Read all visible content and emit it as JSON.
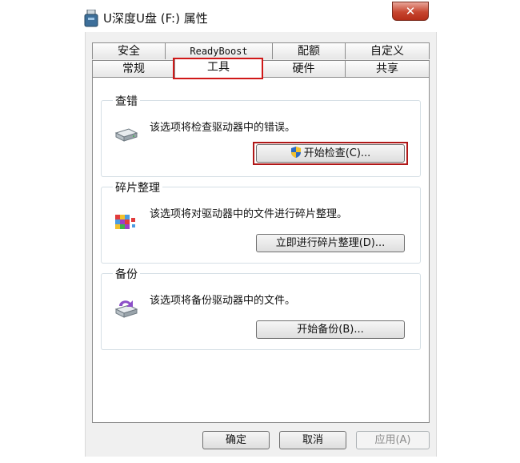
{
  "window": {
    "title": "U深度U盘 (F:) 属性",
    "close_label": "✕"
  },
  "tabs": {
    "top_row": [
      {
        "label": "安全"
      },
      {
        "label": "ReadyBoost"
      },
      {
        "label": "配额"
      },
      {
        "label": "自定义"
      }
    ],
    "bottom_row": [
      {
        "label": "常规"
      },
      {
        "label": "工具",
        "active": true
      },
      {
        "label": "硬件"
      },
      {
        "label": "共享"
      }
    ]
  },
  "groups": {
    "check": {
      "title": "查错",
      "description": "该选项将检查驱动器中的错误。",
      "button": "开始检查(C)..."
    },
    "defrag": {
      "title": "碎片整理",
      "description": "该选项将对驱动器中的文件进行碎片整理。",
      "button": "立即进行碎片整理(D)..."
    },
    "backup": {
      "title": "备份",
      "description": "该选项将备份驱动器中的文件。",
      "button": "开始备份(B)..."
    }
  },
  "footer": {
    "ok": "确定",
    "cancel": "取消",
    "apply": "应用(A)"
  },
  "icons": {
    "title": "usb-drive-icon",
    "check": "drive-icon",
    "defrag": "defrag-icon",
    "backup": "backup-icon",
    "uac": "uac-shield-icon"
  },
  "colors": {
    "highlight_red": "#d01818",
    "close_red": "#c7452f"
  }
}
